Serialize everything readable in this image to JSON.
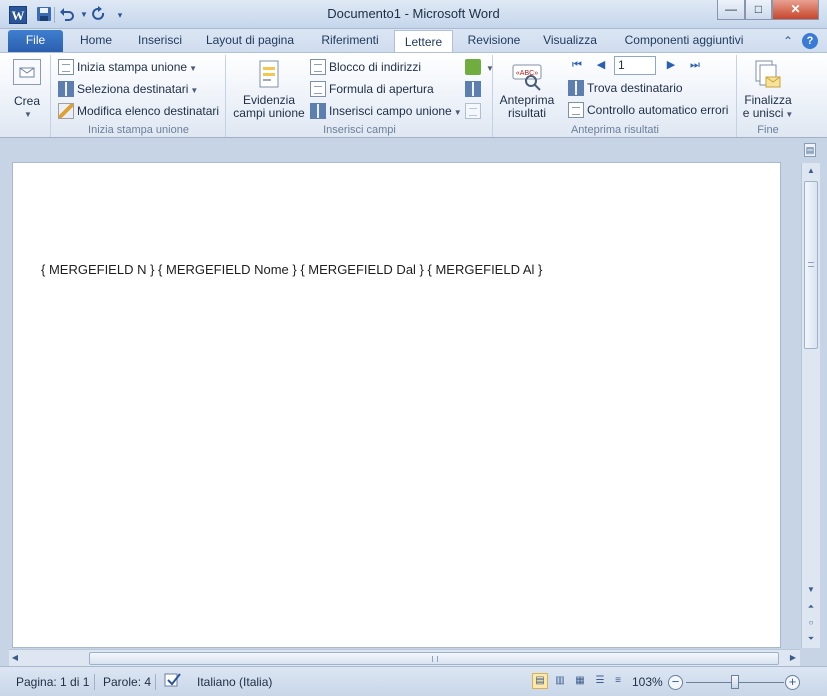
{
  "window": {
    "title": "Documento1",
    "title_sep": " - ",
    "app_name": "Microsoft Word",
    "app_icon_letter": "W",
    "minimize_glyph": "—",
    "maximize_glyph": "□",
    "close_glyph": "✕"
  },
  "qat": {
    "save_icon": "save-icon",
    "undo_icon": "undo-icon",
    "redo_icon": "redo-icon"
  },
  "tabs": [
    {
      "label": "File"
    },
    {
      "label": "Home"
    },
    {
      "label": "Inserisci"
    },
    {
      "label": "Layout di pagina"
    },
    {
      "label": "Riferimenti"
    },
    {
      "label": "Lettere"
    },
    {
      "label": "Revisione"
    },
    {
      "label": "Visualizza"
    },
    {
      "label": "Componenti aggiuntivi"
    }
  ],
  "active_tab": "Lettere",
  "ribbon": {
    "crea": {
      "label": "Crea"
    },
    "inizia": {
      "group_label": "Inizia stampa unione",
      "btn1": "Inizia stampa unione",
      "btn2": "Seleziona destinatari",
      "btn3": "Modifica elenco destinatari"
    },
    "inserisci": {
      "group_label": "Inserisci campi",
      "evidenzia_line1": "Evidenzia",
      "evidenzia_line2": "campi unione",
      "blocco": "Blocco di indirizzi",
      "formula": "Formula di apertura",
      "campo": "Inserisci campo unione"
    },
    "anteprima": {
      "group_label": "Anteprima risultati",
      "big_line1": "Anteprima",
      "big_line2": "risultati",
      "record_value": "1",
      "trova": "Trova destinatario",
      "controllo": "Controllo automatico errori"
    },
    "fine": {
      "group_label": "Fine",
      "line1": "Finalizza",
      "line2": "e unisci"
    }
  },
  "document": {
    "merge_line": "{ MERGEFIELD N } { MERGEFIELD Nome } { MERGEFIELD Dal } { MERGEFIELD Al }"
  },
  "status": {
    "page": "Pagina: 1 di 1",
    "words": "Parole: 4",
    "language": "Italiano (Italia)",
    "zoom": "103%",
    "zoom_level": 0.53
  },
  "colors": {
    "file_tab": "#2b5fae",
    "accent": "#2a5699"
  }
}
